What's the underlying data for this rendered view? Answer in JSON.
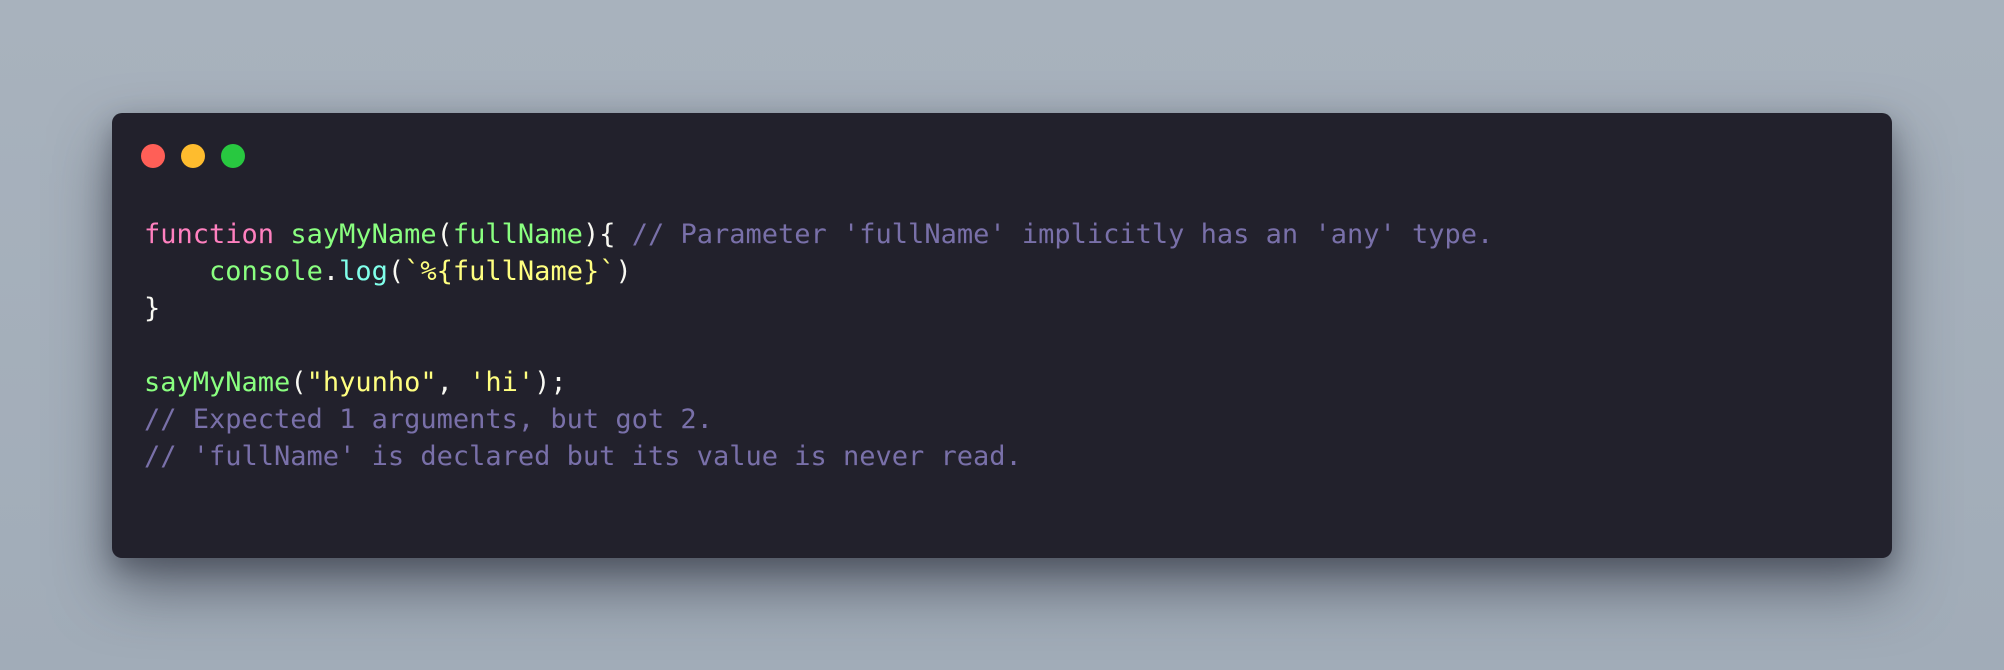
{
  "window": {
    "controls": [
      {
        "name": "close",
        "color": "#ff5f57"
      },
      {
        "name": "minimize",
        "color": "#febc2e"
      },
      {
        "name": "maximize",
        "color": "#28c840"
      }
    ]
  },
  "colors": {
    "background": "#a8b2bd",
    "editor_bg": "#22212c",
    "keyword": "#ff80bf",
    "function": "#8aff80",
    "method": "#80ffea",
    "string": "#ffff80",
    "comment": "#7970a9",
    "text": "#f8f8f2"
  },
  "code": {
    "line1": {
      "keyword": "function",
      "fn_name": "sayMyName",
      "open_paren": "(",
      "param": "fullName",
      "close": "){",
      "comment": "// Parameter 'fullName' implicitly has an 'any' type."
    },
    "line2": {
      "indent": "    ",
      "object": "console",
      "dot": ".",
      "method": "log",
      "open_paren": "(",
      "template": "`%{fullName}`",
      "close_paren": ")"
    },
    "line3": {
      "brace": "}"
    },
    "line5": {
      "fn_name": "sayMyName",
      "open_paren": "(",
      "arg1": "\"hyunho\"",
      "comma": ", ",
      "arg2": "'hi'",
      "close": ");"
    },
    "line6": {
      "comment": "// Expected 1 arguments, but got 2."
    },
    "line7": {
      "comment": "// 'fullName' is declared but its value is never read."
    }
  }
}
